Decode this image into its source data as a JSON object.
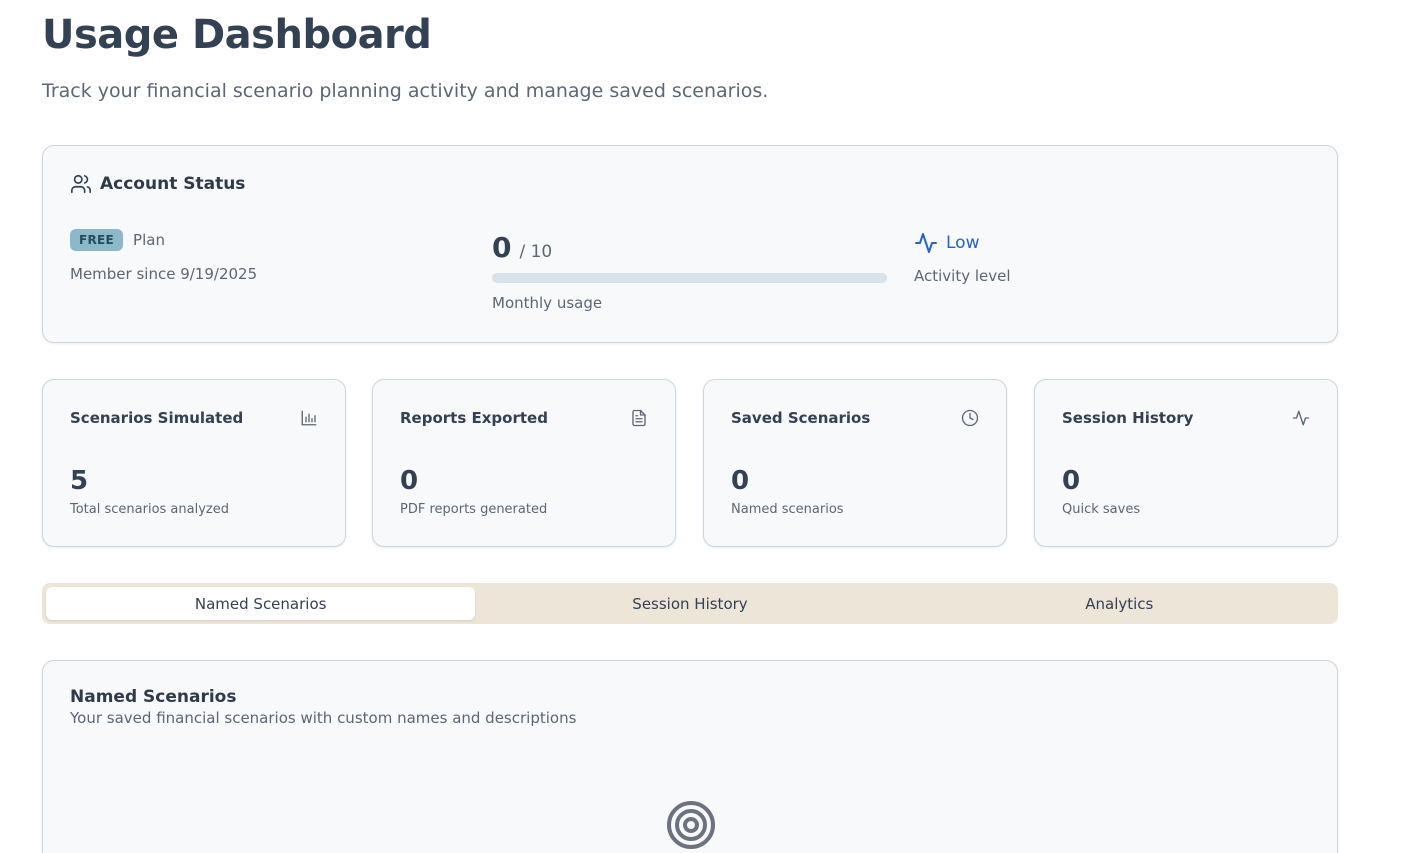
{
  "header": {
    "title": "Usage Dashboard",
    "subtitle": "Track your financial scenario planning activity and manage saved scenarios."
  },
  "account": {
    "title": "Account Status",
    "icon": "users-icon",
    "plan_badge": "FREE",
    "plan_label": "Plan",
    "member_since": "Member since 9/19/2025",
    "usage_count": "0",
    "usage_limit": "/ 10",
    "usage_fraction": 0,
    "usage_caption": "Monthly usage",
    "activity_icon": "activity-icon",
    "activity_value": "Low",
    "activity_caption": "Activity level",
    "accent_color": "#2563c9"
  },
  "stats": [
    {
      "title": "Scenarios Simulated",
      "icon": "bar-chart-icon",
      "value": "5",
      "caption": "Total scenarios analyzed"
    },
    {
      "title": "Reports Exported",
      "icon": "file-text-icon",
      "value": "0",
      "caption": "PDF reports generated"
    },
    {
      "title": "Saved Scenarios",
      "icon": "clock-icon",
      "value": "0",
      "caption": "Named scenarios"
    },
    {
      "title": "Session History",
      "icon": "activity-icon",
      "value": "0",
      "caption": "Quick saves"
    }
  ],
  "tabs": [
    {
      "label": "Named Scenarios",
      "active": true
    },
    {
      "label": "Session History",
      "active": false
    },
    {
      "label": "Analytics",
      "active": false
    }
  ],
  "named_scenarios": {
    "title": "Named Scenarios",
    "description": "Your saved financial scenarios with custom names and descriptions",
    "empty_icon": "target-icon"
  }
}
